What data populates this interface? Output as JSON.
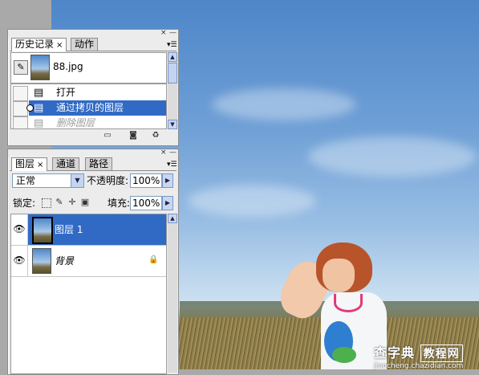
{
  "history_panel": {
    "tabs": [
      {
        "label": "历史记录",
        "close": "×"
      },
      {
        "label": "动作"
      }
    ],
    "close_glyph": "×",
    "minimize_glyph": "—",
    "menu_glyph": "▾☰",
    "snapshot": {
      "label": "88.jpg"
    },
    "states": [
      {
        "label": "打开"
      },
      {
        "label": "通过拷贝的图层"
      },
      {
        "label": "删除图层"
      }
    ],
    "footer_icons": [
      "new-document-icon",
      "camera-icon",
      "trash-icon"
    ]
  },
  "layers_panel": {
    "tabs": [
      {
        "label": "图层",
        "close": "×"
      },
      {
        "label": "通道"
      },
      {
        "label": "路径"
      }
    ],
    "close_glyph": "×",
    "minimize_glyph": "—",
    "menu_glyph": "▾☰",
    "blend_mode": "正常",
    "opacity_label": "不透明度:",
    "opacity_value": "100%",
    "lock_label": "锁定:",
    "fill_label": "填充:",
    "fill_value": "100%",
    "layers": [
      {
        "name": "图层 1"
      },
      {
        "name": "背景"
      }
    ]
  },
  "watermark": {
    "main_text": "查字典",
    "box_text": "教程网",
    "sub_text": "jiaocheng.chazidian.com"
  },
  "colors": {
    "selection": "#316ac5",
    "panel_bg": "#ececec",
    "workspace_bg": "#a9a9a9"
  }
}
